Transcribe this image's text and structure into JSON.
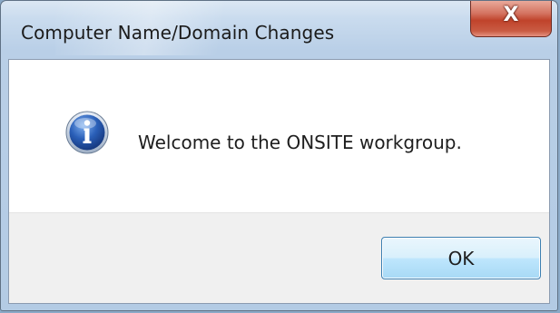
{
  "dialog": {
    "title": "Computer Name/Domain Changes",
    "close_glyph": "X",
    "message": "Welcome to the ONSITE workgroup.",
    "icon": "information-icon",
    "ok_label": "OK"
  },
  "colors": {
    "title_bar": "#c9dbee",
    "close_button": "#c0432b",
    "ok_button_border": "#3c7fb1",
    "info_icon": "#2a5fb8",
    "footer": "#f0f0f0"
  }
}
